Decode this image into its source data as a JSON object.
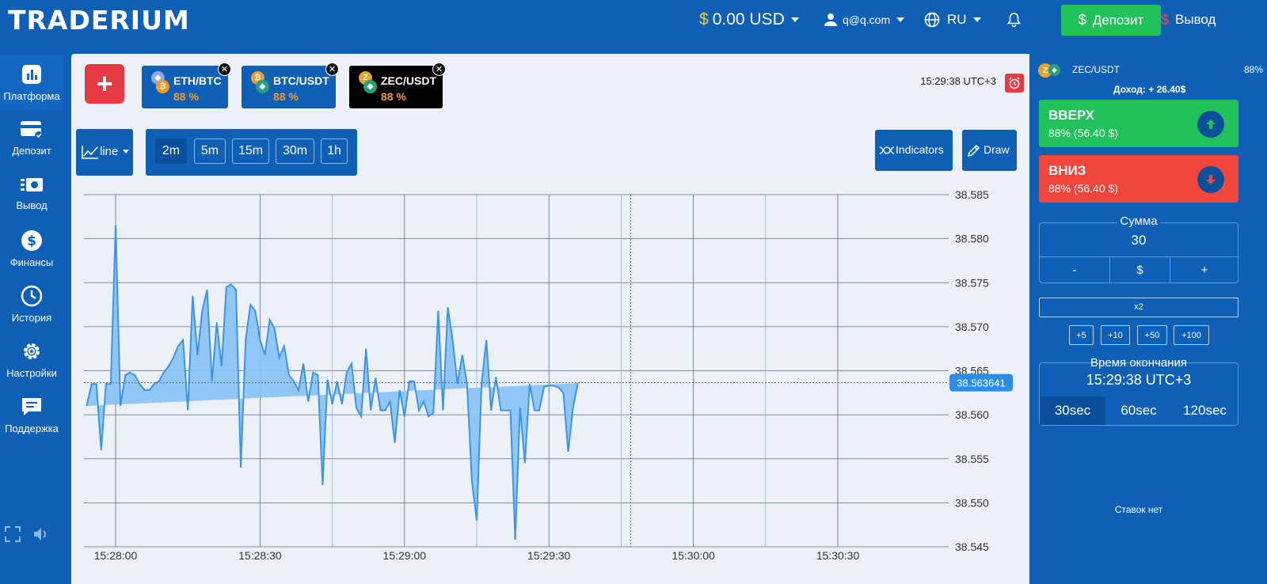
{
  "header": {
    "logo": "TRADERIUM",
    "balance_symbol": "$",
    "balance": "0.00 USD",
    "account": "q@q.com",
    "language": "RU",
    "deposit_label": "Депозит",
    "withdraw_label": "Вывод"
  },
  "sidebar": {
    "items": [
      {
        "label": "Платформа",
        "icon": "chart-bar-icon"
      },
      {
        "label": "Депозит",
        "icon": "credit-card-icon"
      },
      {
        "label": "Вывод",
        "icon": "cash-icon"
      },
      {
        "label": "Финансы",
        "icon": "dollar-circle-icon"
      },
      {
        "label": "История",
        "icon": "clock-icon"
      },
      {
        "label": "Настройки",
        "icon": "gear-icon"
      },
      {
        "label": "Поддержка",
        "icon": "chat-icon"
      }
    ]
  },
  "tabs": [
    {
      "name": "ETH/BTC",
      "pct": "88 %"
    },
    {
      "name": "BTC/USDT",
      "pct": "88 %"
    },
    {
      "name": "ZEC/USDT",
      "pct": "88 %"
    }
  ],
  "clock": "15:29:38 UTC+3",
  "toolbar": {
    "chart_type": "line",
    "timeframes": [
      "2m",
      "5m",
      "15m",
      "30m",
      "1h"
    ],
    "active_timeframe": "2m",
    "indicators_label": "Indicators",
    "draw_label": "Draw"
  },
  "chart_data": {
    "type": "area",
    "ylim": [
      38.545,
      38.585
    ],
    "y_ticks": [
      "38.585",
      "38.580",
      "38.575",
      "38.570",
      "38.565",
      "38.560",
      "38.555",
      "38.550",
      "38.545"
    ],
    "x_ticks": [
      "15:28:00",
      "15:28:30",
      "15:29:00",
      "15:29:30",
      "15:30:00",
      "15:30:30"
    ],
    "current_price": "38.563641",
    "x_seconds_from_first_tick": [
      -6,
      -5,
      -4,
      -3,
      -2,
      -1,
      0,
      1,
      2,
      3,
      4,
      5,
      6,
      7,
      8,
      9,
      10,
      11,
      12,
      13,
      14,
      15,
      16,
      17,
      18,
      19,
      20,
      21,
      22,
      23,
      24,
      25,
      26,
      27,
      28,
      29,
      30,
      31,
      32,
      33,
      34,
      35,
      36,
      37,
      38,
      39,
      40,
      41,
      42,
      43,
      44,
      45,
      46,
      47,
      48,
      49,
      50,
      51,
      52,
      53,
      54,
      55,
      56,
      57,
      58,
      59,
      60,
      61,
      62,
      63,
      64,
      65,
      66,
      67,
      68,
      69,
      70,
      71,
      72,
      73,
      74,
      75,
      76,
      77,
      78,
      79,
      80,
      81,
      82,
      83,
      84,
      85,
      86,
      87,
      88,
      89,
      90,
      91,
      92,
      93,
      94,
      95,
      96,
      97,
      98,
      99,
      100,
      101,
      102,
      103,
      104,
      105,
      106,
      107
    ],
    "values": [
      38.561,
      38.5635,
      38.5635,
      38.556,
      38.5635,
      38.5635,
      38.5815,
      38.561,
      38.5645,
      38.5648,
      38.5645,
      38.5635,
      38.5628,
      38.5628,
      38.5635,
      38.5638,
      38.5648,
      38.5655,
      38.5665,
      38.5678,
      38.5685,
      38.5605,
      38.5735,
      38.5668,
      38.5718,
      38.5742,
      38.5638,
      38.5705,
      38.5655,
      38.5745,
      38.5748,
      38.5742,
      38.554,
      38.5685,
      38.5725,
      38.5718,
      38.5685,
      38.5668,
      38.5708,
      38.5698,
      38.5665,
      38.5678,
      38.5645,
      38.5638,
      38.5628,
      38.5658,
      38.5615,
      38.5648,
      38.5645,
      38.552,
      38.564,
      38.5612,
      38.5638,
      38.5612,
      38.5648,
      38.5658,
      38.5608,
      38.5598,
      38.5675,
      38.5605,
      38.5642,
      38.5605,
      38.5605,
      38.5615,
      38.5568,
      38.5628,
      38.5598,
      38.5638,
      38.5638,
      38.5605,
      38.5615,
      38.5598,
      38.5602,
      38.5718,
      38.5605,
      38.5722,
      38.5685,
      38.5635,
      38.5668,
      38.5635,
      38.5525,
      38.548,
      38.5635,
      38.5685,
      38.5605,
      38.5643,
      38.5605,
      38.5605,
      38.5605,
      38.5458,
      38.5608,
      38.5545,
      38.5635,
      38.5605,
      38.5605,
      38.5632,
      38.5633,
      38.5633,
      38.5631,
      38.5625,
      38.5558,
      38.5608,
      38.5636
    ]
  },
  "right_panel": {
    "pair": "ZEC/USDT",
    "payout": "88%",
    "income": "Доход: + 26.40$",
    "up_label": "ВВЕРХ",
    "up_sub": "88% (56.40 $)",
    "down_label": "ВНИЗ",
    "down_sub": "88% (56.40 $)",
    "amount_label": "Сумма",
    "amount_value": "30",
    "minus": "-",
    "currency": "$",
    "plus": "+",
    "multiplier": "x2",
    "quick_adds": [
      "+5",
      "+10",
      "+50",
      "+100"
    ],
    "expiry_label": "Время окончания",
    "expiry_value": "15:29:38 UTC+3",
    "durations": [
      "30sec",
      "60sec",
      "120sec"
    ],
    "no_bets": "Ставок нет"
  },
  "colors": {
    "primary": "#0e5fb6",
    "up": "#21c15c",
    "down": "#f0463c",
    "area_fill": "#8cc4f7",
    "line": "#3d94e4"
  }
}
